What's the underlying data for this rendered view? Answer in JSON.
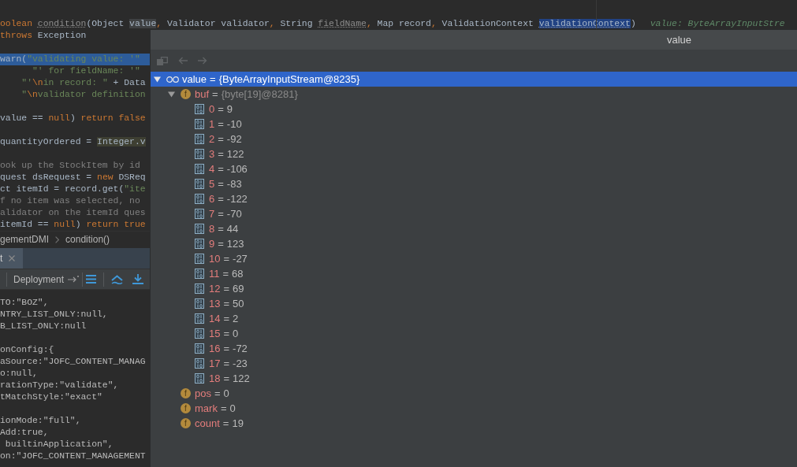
{
  "editor": {
    "blocks": [
      [
        {
          "execution_point": false,
          "tokens": [
            {
              "text": "oolean ",
              "kind": "keyword"
            },
            {
              "text": "condition",
              "kind": "unused"
            },
            {
              "text": "(Object ",
              "kind": "plain"
            },
            {
              "text": "value",
              "kind": "usage"
            },
            {
              "text": ",",
              "kind": "separator"
            },
            {
              "text": " Validator validator",
              "kind": "plain"
            },
            {
              "text": ",",
              "kind": "separator"
            },
            {
              "text": " String ",
              "kind": "plain"
            },
            {
              "text": "fieldName",
              "kind": "unused"
            },
            {
              "text": ",",
              "kind": "separator"
            },
            {
              "text": " Map record",
              "kind": "plain"
            },
            {
              "text": ",",
              "kind": "separator"
            },
            {
              "text": " ValidationContext ",
              "kind": "plain"
            },
            {
              "text": "validationContext",
              "kind": "selection"
            },
            {
              "text": ")",
              "kind": "plain"
            }
          ],
          "hint": "value: ByteArrayInputStre"
        },
        {
          "execution_point": false,
          "tokens": [
            {
              "text": "throws ",
              "kind": "keyword"
            },
            {
              "text": "Exception",
              "kind": "plain"
            }
          ]
        }
      ],
      [
        {
          "execution_point": true,
          "tokens": [
            {
              "text": "warn(",
              "kind": "plain"
            },
            {
              "text": "\"validating value: '\"",
              "kind": "string"
            }
          ]
        },
        {
          "execution_point": false,
          "tokens": [
            {
              "text": "      \"' for fieldName: '\"",
              "kind": "string"
            }
          ]
        },
        {
          "execution_point": false,
          "tokens": [
            {
              "text": "    \"'",
              "kind": "string"
            },
            {
              "text": "\\n",
              "kind": "escape"
            },
            {
              "text": "in record: \"",
              "kind": "string"
            },
            {
              "text": " + Data",
              "kind": "plain"
            }
          ]
        },
        {
          "execution_point": false,
          "tokens": [
            {
              "text": "    \"",
              "kind": "string"
            },
            {
              "text": "\\n",
              "kind": "escape"
            },
            {
              "text": "validator definition",
              "kind": "string"
            }
          ]
        }
      ],
      [
        {
          "execution_point": false,
          "tokens": [
            {
              "text": "value == ",
              "kind": "plain"
            },
            {
              "text": "null",
              "kind": "keyword"
            },
            {
              "text": ") ",
              "kind": "plain"
            },
            {
              "text": "return false",
              "kind": "keyword"
            }
          ]
        }
      ],
      [
        {
          "execution_point": false,
          "tokens": [
            {
              "text": "quantityOrdered = ",
              "kind": "plain"
            },
            {
              "text": "Integer.v",
              "kind": "found"
            }
          ]
        }
      ],
      [
        {
          "execution_point": false,
          "tokens": [
            {
              "text": "ook up the StockItem by id",
              "kind": "comment"
            }
          ]
        },
        {
          "execution_point": false,
          "tokens": [
            {
              "text": "quest dsRequest = ",
              "kind": "plain"
            },
            {
              "text": "new ",
              "kind": "keyword"
            },
            {
              "text": "DSReq",
              "kind": "plain"
            }
          ]
        },
        {
          "execution_point": false,
          "tokens": [
            {
              "text": "ct itemId = record.get(",
              "kind": "plain"
            },
            {
              "text": "\"ite",
              "kind": "string"
            }
          ]
        },
        {
          "execution_point": false,
          "tokens": [
            {
              "text": "f no item was selected, no",
              "kind": "comment"
            }
          ]
        },
        {
          "execution_point": false,
          "tokens": [
            {
              "text": "alidator on the itemId ques",
              "kind": "comment"
            }
          ]
        },
        {
          "execution_point": false,
          "tokens": [
            {
              "text": "itemId == ",
              "kind": "plain"
            },
            {
              "text": "null",
              "kind": "keyword"
            },
            {
              "text": ") ",
              "kind": "plain"
            },
            {
              "text": "return true",
              "kind": "keyword"
            }
          ]
        }
      ]
    ]
  },
  "breadcrumbs": [
    "gementDMI",
    "condition()"
  ],
  "tool_window": {
    "tabs": [
      {
        "label": "t",
        "selected": true
      }
    ],
    "toolbar": {
      "label": "Deployment"
    },
    "console": [
      [
        "TO:\"BOZ\",",
        "NTRY_LIST_ONLY:null,",
        "B_LIST_ONLY:null"
      ],
      [
        "onConfig:{",
        "aSource:\"JOFC_CONTENT_MANAG",
        "o:null,",
        "rationType:\"validate\",",
        "tMatchStyle:\"exact\""
      ],
      [
        "ionMode:\"full\",",
        "Add:true,",
        " builtinApplication\",",
        "on:\"JOFC_CONTENT_MANAGEMENT"
      ]
    ]
  },
  "popup": {
    "title": "value",
    "toolbar": [
      {
        "kind": "stack",
        "disabled": true
      },
      {
        "kind": "back",
        "disabled": true
      },
      {
        "kind": "forward",
        "disabled": true
      }
    ],
    "tree": [
      {
        "kind": "object",
        "name": "value",
        "operator": "=",
        "value": "{ByteArrayInputStream@8235}",
        "selected": true,
        "expanded": true,
        "children": [
          {
            "kind": "field",
            "badge": "f",
            "name": "buf",
            "operator": "=",
            "value": "{byte[19]@8281}",
            "selected": false,
            "expanded": true,
            "children": [
              {
                "kind": "element",
                "name": "0",
                "operator": "=",
                "value": "9",
                "selected": false
              },
              {
                "kind": "element",
                "name": "1",
                "operator": "=",
                "value": "-10",
                "selected": false
              },
              {
                "kind": "element",
                "name": "2",
                "operator": "=",
                "value": "-92",
                "selected": false
              },
              {
                "kind": "element",
                "name": "3",
                "operator": "=",
                "value": "122",
                "selected": false
              },
              {
                "kind": "element",
                "name": "4",
                "operator": "=",
                "value": "-106",
                "selected": false
              },
              {
                "kind": "element",
                "name": "5",
                "operator": "=",
                "value": "-83",
                "selected": false
              },
              {
                "kind": "element",
                "name": "6",
                "operator": "=",
                "value": "-122",
                "selected": false
              },
              {
                "kind": "element",
                "name": "7",
                "operator": "=",
                "value": "-70",
                "selected": false
              },
              {
                "kind": "element",
                "name": "8",
                "operator": "=",
                "value": "44",
                "selected": false
              },
              {
                "kind": "element",
                "name": "9",
                "operator": "=",
                "value": "123",
                "selected": false
              },
              {
                "kind": "element",
                "name": "10",
                "operator": "=",
                "value": "-27",
                "selected": false
              },
              {
                "kind": "element",
                "name": "11",
                "operator": "=",
                "value": "68",
                "selected": false
              },
              {
                "kind": "element",
                "name": "12",
                "operator": "=",
                "value": "69",
                "selected": false
              },
              {
                "kind": "element",
                "name": "13",
                "operator": "=",
                "value": "50",
                "selected": false
              },
              {
                "kind": "element",
                "name": "14",
                "operator": "=",
                "value": "2",
                "selected": false
              },
              {
                "kind": "element",
                "name": "15",
                "operator": "=",
                "value": "0",
                "selected": false
              },
              {
                "kind": "element",
                "name": "16",
                "operator": "=",
                "value": "-72",
                "selected": false
              },
              {
                "kind": "element",
                "name": "17",
                "operator": "=",
                "value": "-23",
                "selected": false
              },
              {
                "kind": "element",
                "name": "18",
                "operator": "=",
                "value": "122",
                "selected": false
              }
            ]
          },
          {
            "kind": "field",
            "badge": "f",
            "name": "pos",
            "operator": "=",
            "value": "0",
            "selected": false
          },
          {
            "kind": "field",
            "badge": "f",
            "name": "mark",
            "operator": "=",
            "value": "0",
            "selected": false
          },
          {
            "kind": "field",
            "badge": "f",
            "name": "count",
            "operator": "=",
            "value": "19",
            "selected": false
          }
        ]
      }
    ]
  }
}
